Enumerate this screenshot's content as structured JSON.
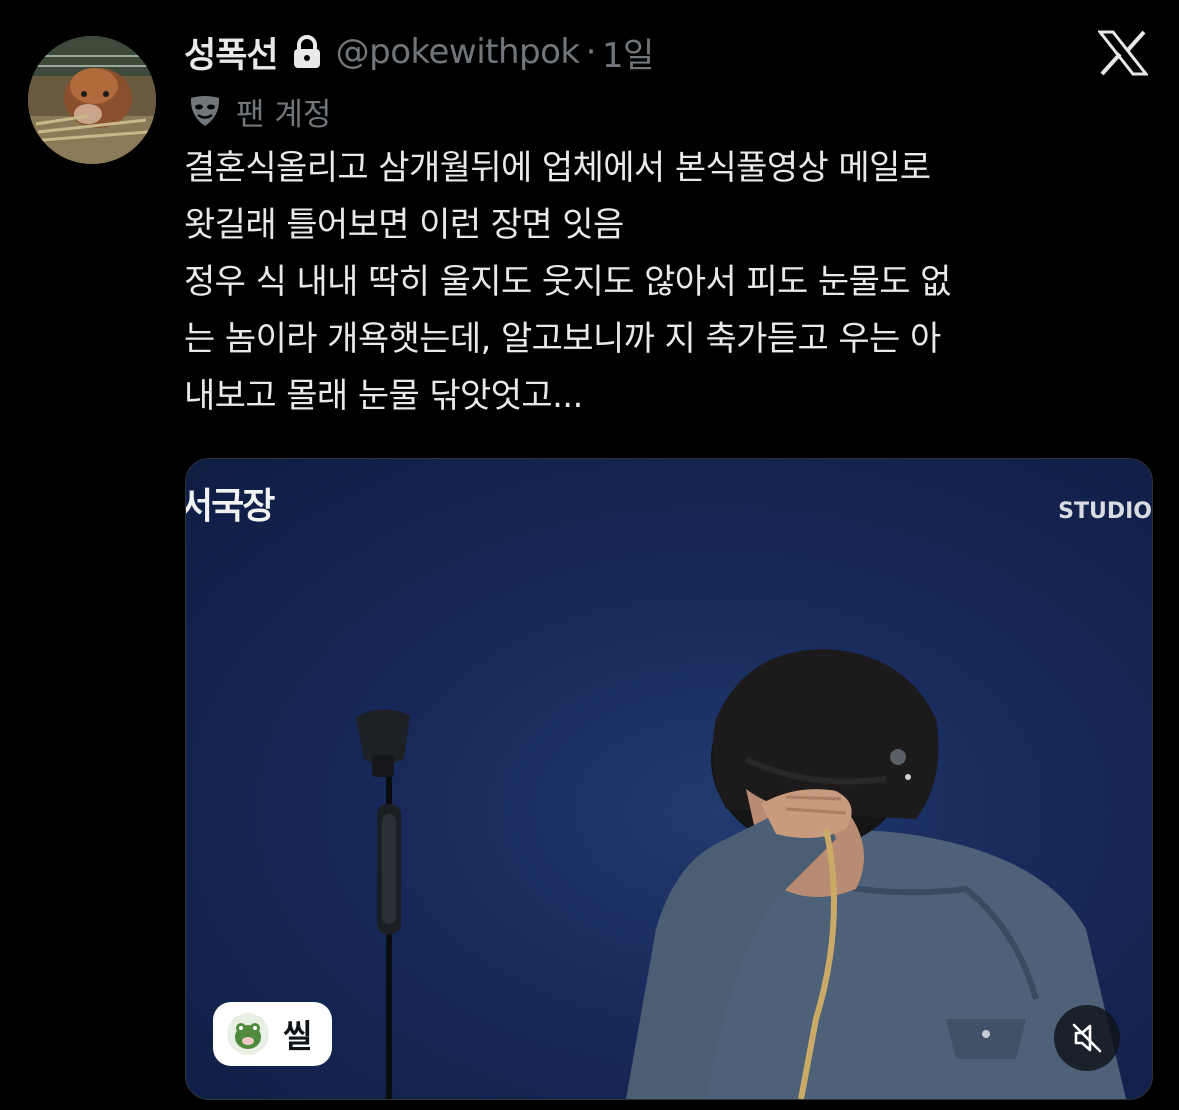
{
  "author": {
    "display_name": "성폭선",
    "handle": "@pokewithpok",
    "separator": "·",
    "time": "1일",
    "avatar_icon": "calf-photo-avatar",
    "protected_icon": "lock-icon"
  },
  "badge": {
    "icon": "mask-icon",
    "label": "팬 계정"
  },
  "app": {
    "logo_icon": "x-logo-icon"
  },
  "tweet": {
    "lines": [
      "결혼식올리고 삼개월뒤에 업체에서 본식풀영상 메일로",
      "왓길래 틀어보면 이런 장면 잇음",
      "정우 식 내내 딱히 울지도 웃지도 않아서 피도 눈물도 없",
      "는 놈이라 개욕햇는데, 알고보니까 지 축가듣고 우는 아",
      "내보고 몰래 눈물 닦앗엇고..."
    ]
  },
  "media": {
    "corner_title": "서국장",
    "watermark": "STUDIO",
    "channel_chip": {
      "label": "씰",
      "icon": "channel-avatar-icon"
    },
    "mute_icon": "speaker-muted-icon",
    "background_color": "#17295a"
  },
  "colors": {
    "background": "#000000",
    "primary_text": "#e7e9ea",
    "secondary_text": "#71767b"
  }
}
